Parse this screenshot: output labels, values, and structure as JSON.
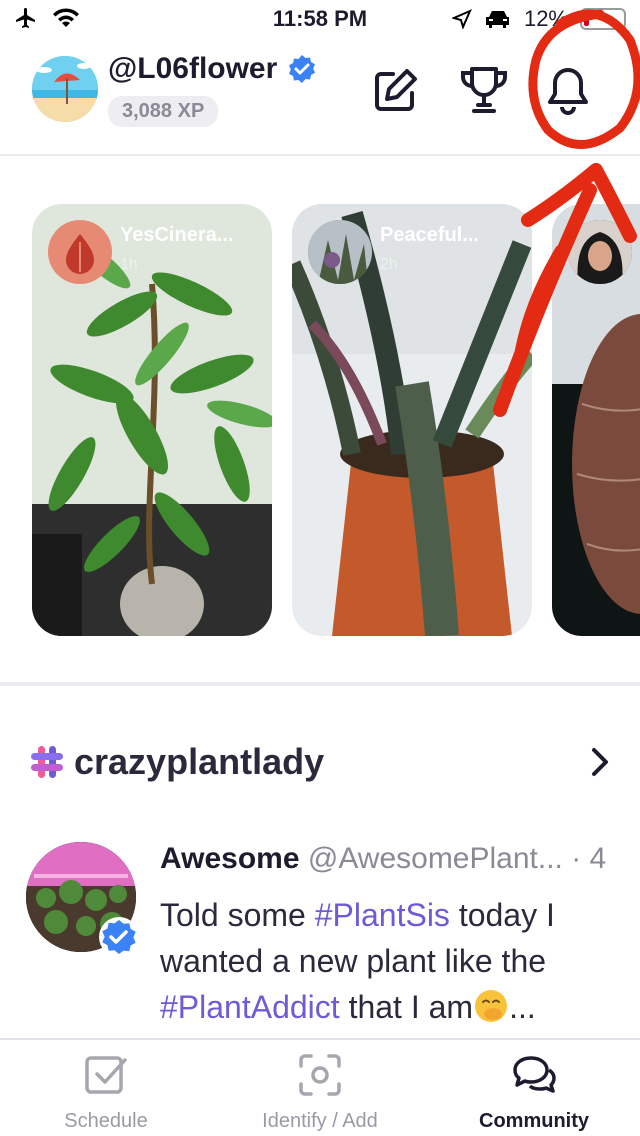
{
  "status_bar": {
    "time": "11:58 PM",
    "battery": "12%",
    "battery_level": 0.12,
    "icons": [
      "airplane-icon",
      "wifi-icon",
      "location-arrow-icon",
      "car-icon",
      "battery-icon"
    ]
  },
  "header": {
    "username": "@L06flower",
    "xp": "3,088 XP",
    "icons": [
      "edit-icon",
      "trophy-icon",
      "bell-icon"
    ]
  },
  "stories": [
    {
      "name": "YesCinera...",
      "time": "1h",
      "avatar_icon": "leaf-drop-icon"
    },
    {
      "name": "Peaceful...",
      "time": "2h"
    },
    {
      "name": ""
    }
  ],
  "hashtag_section": {
    "title": "crazyplantlady",
    "icon": "hashtag-icon"
  },
  "post": {
    "author": "Awesome",
    "handle": "@AwesomePlant... · 4",
    "text_parts": {
      "p1": "Told some ",
      "tag1": "#PlantSis",
      "p2": " today I wanted a new plant like the ",
      "tag2": "#PlantAddict",
      "p3": " that I am",
      "ellipsis": "..."
    }
  },
  "tabs": [
    {
      "label": "Schedule",
      "icon": "checkbox-icon"
    },
    {
      "label": "Identify / Add",
      "icon": "scan-icon"
    },
    {
      "label": "Community",
      "icon": "chat-bubbles-icon",
      "active": true
    }
  ],
  "colors": {
    "accent": "#6e5bd6",
    "verified": "#3b82f6",
    "annotation": "#e32b13"
  }
}
